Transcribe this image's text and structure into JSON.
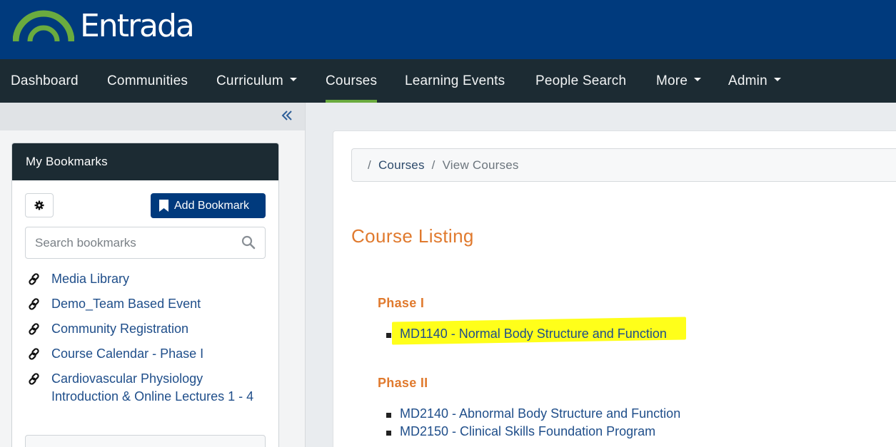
{
  "brand": {
    "name": "Entrada"
  },
  "nav": {
    "items": [
      {
        "label": "Dashboard"
      },
      {
        "label": "Communities"
      },
      {
        "label": "Curriculum"
      },
      {
        "label": "Courses"
      },
      {
        "label": "Learning Events"
      },
      {
        "label": "People Search"
      },
      {
        "label": "More"
      },
      {
        "label": "Admin"
      }
    ],
    "active": "Courses"
  },
  "bookmarks": {
    "title": "My Bookmarks",
    "add_label": "Add Bookmark",
    "search_placeholder": "Search bookmarks",
    "items": [
      {
        "label": "Media Library"
      },
      {
        "label": "Demo_Team Based Event"
      },
      {
        "label": "Community Registration"
      },
      {
        "label": "Course Calendar - Phase I"
      },
      {
        "label": "Cardiovascular Physiology Introduction & Online Lectures 1 - 4"
      }
    ]
  },
  "breadcrumb": {
    "separator": "/",
    "items": [
      {
        "label": "Courses"
      },
      {
        "label": "View Courses"
      }
    ]
  },
  "main": {
    "title": "Course Listing",
    "phases": [
      {
        "title": "Phase I",
        "courses": [
          {
            "label": "MD1140 - Normal Body Structure and Function"
          }
        ]
      },
      {
        "title": "Phase II",
        "courses": [
          {
            "label": "MD2140 - Abnormal Body Structure and Function"
          },
          {
            "label": "MD2150 - Clinical Skills Foundation Program"
          }
        ]
      }
    ]
  },
  "colors": {
    "header_bg": "#003a7d",
    "nav_bg": "#1c2b33",
    "active_underline": "#6aab3f",
    "accent_orange": "#e07a2e",
    "link_blue": "#1f4e8a",
    "highlight": "#ffff1a"
  }
}
